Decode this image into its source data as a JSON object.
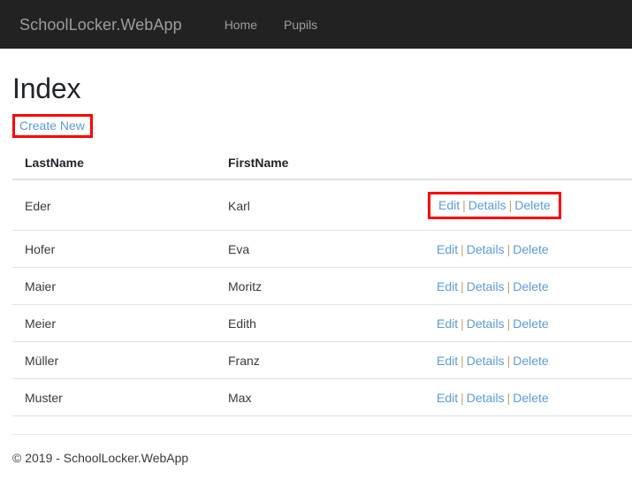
{
  "navbar": {
    "brand": "SchoolLocker.WebApp",
    "links": [
      {
        "label": "Home"
      },
      {
        "label": "Pupils"
      }
    ]
  },
  "page": {
    "title": "Index",
    "create_new_label": "Create New"
  },
  "table": {
    "headers": {
      "last_name": "LastName",
      "first_name": "FirstName",
      "actions": ""
    },
    "action_labels": {
      "edit": "Edit",
      "details": "Details",
      "delete": "Delete",
      "separator": "|"
    },
    "rows": [
      {
        "last_name": "Eder",
        "first_name": "Karl",
        "highlighted": true
      },
      {
        "last_name": "Hofer",
        "first_name": "Eva",
        "highlighted": false
      },
      {
        "last_name": "Maier",
        "first_name": "Moritz",
        "highlighted": false
      },
      {
        "last_name": "Meier",
        "first_name": "Edith",
        "highlighted": false
      },
      {
        "last_name": "Müller",
        "first_name": "Franz",
        "highlighted": false
      },
      {
        "last_name": "Muster",
        "first_name": "Max",
        "highlighted": false
      }
    ]
  },
  "footer": {
    "text": "© 2019 - SchoolLocker.WebApp"
  },
  "colors": {
    "navbar_bg": "#222222",
    "navbar_text": "#9d9d9d",
    "link": "#5b9bd5",
    "highlight_border": "#ff0000",
    "table_border": "#dee2e6",
    "body_text": "#373a3c"
  }
}
